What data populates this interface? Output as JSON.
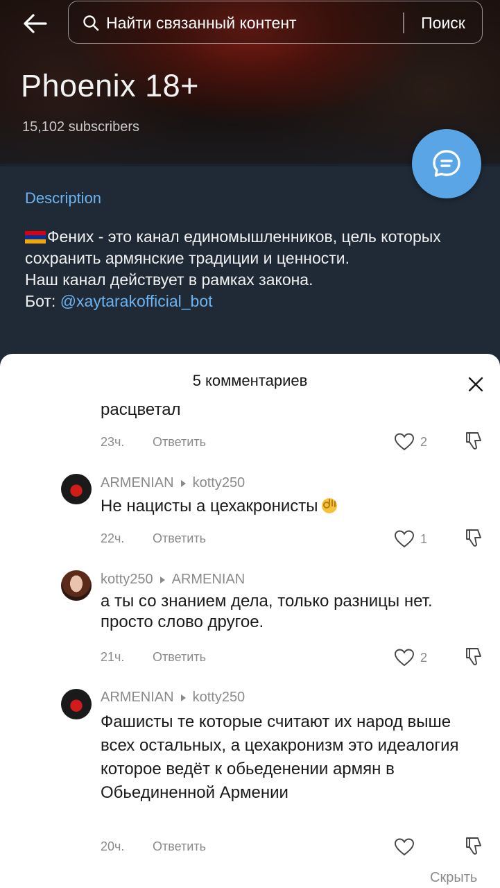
{
  "header": {
    "search_placeholder": "Найти связанный контент",
    "search_button": "Поиск"
  },
  "channel": {
    "title": "Phoenix 18+",
    "subscribers": "15,102 subscribers",
    "description_heading": "Description",
    "description_lines": [
      "Фених - это канал единомышленников, цель которых сохранить армянские традиции и ценности.",
      "Наш канал действует в рамках закона."
    ],
    "bot_label": "Бот: ",
    "bot_link": "@xaytarakofficial_bot"
  },
  "sheet": {
    "title": "5 комментариев",
    "hide_label": "Скрыть"
  },
  "reply_label": "Ответить",
  "comments": [
    {
      "author": "",
      "reply_to": "",
      "text": "расцветал",
      "time": "23ч.",
      "likes": "2"
    },
    {
      "author": "ARMENIAN",
      "reply_to": "kotty250",
      "text": "Не нацисты а цехакронисты",
      "time": "22ч.",
      "likes": "1"
    },
    {
      "author": "kotty250",
      "reply_to": "ARMENIAN",
      "text": "а ты со знанием дела, только разницы нет. просто слово другое.",
      "time": "21ч.",
      "likes": "2"
    },
    {
      "author": "ARMENIAN",
      "reply_to": "kotty250",
      "text": "Фашисты те которые считают их народ выше всех остальных, а цехакронизм это идеалогия которое ведёт к обьеденении армян в Обьединенной Армении",
      "time": "20ч.",
      "likes": ""
    }
  ],
  "icons": {
    "back": "arrow-left-icon",
    "search": "search-icon",
    "chat": "chat-bubble-icon",
    "close": "close-icon",
    "like": "heart-outline-icon",
    "dislike": "thumbs-down-outline-icon"
  },
  "colors": {
    "accent_blue": "#5aa5e6",
    "link_blue": "#6cb3f0",
    "channel_bg": "#1f2a36",
    "meta_gray": "#8a8a8a"
  }
}
